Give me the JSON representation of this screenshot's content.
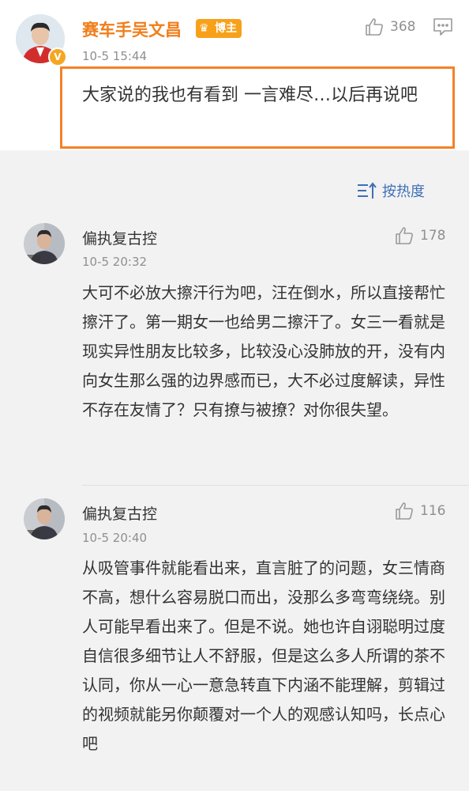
{
  "post": {
    "author": "赛车手吴文昌",
    "badge": "博主",
    "time": "10-5 15:44",
    "likes": "368",
    "text": "大家说的我也有看到 一言难尽…以后再说吧"
  },
  "sort": {
    "label": "按热度"
  },
  "comments": [
    {
      "user": "偏执复古控",
      "time": "10-5 20:32",
      "likes": "178",
      "text": "大可不必放大擦汗行为吧，汪在倒水，所以直接帮忙擦汗了。第一期女一也给男二擦汗了。女三一看就是现实异性朋友比较多，比较没心没肺放的开，没有内向女生那么强的边界感而已，大不必过度解读，异性不存在友情了？只有撩与被撩？对你很失望。"
    },
    {
      "user": "偏执复古控",
      "time": "10-5 20:40",
      "likes": "116",
      "text": "从吸管事件就能看出来，直言脏了的问题，女三情商不高，想什么容易脱口而出，没那么多弯弯绕绕。别人可能早看出来了。但是不说。她也许自诩聪明过度自信很多细节让人不舒服，但是这么多人所谓的茶不认同，你从一心一意急转直下内涵不能理解，剪辑过的视频就能另你颠覆对一个人的观感认知吗，长点心吧"
    }
  ]
}
